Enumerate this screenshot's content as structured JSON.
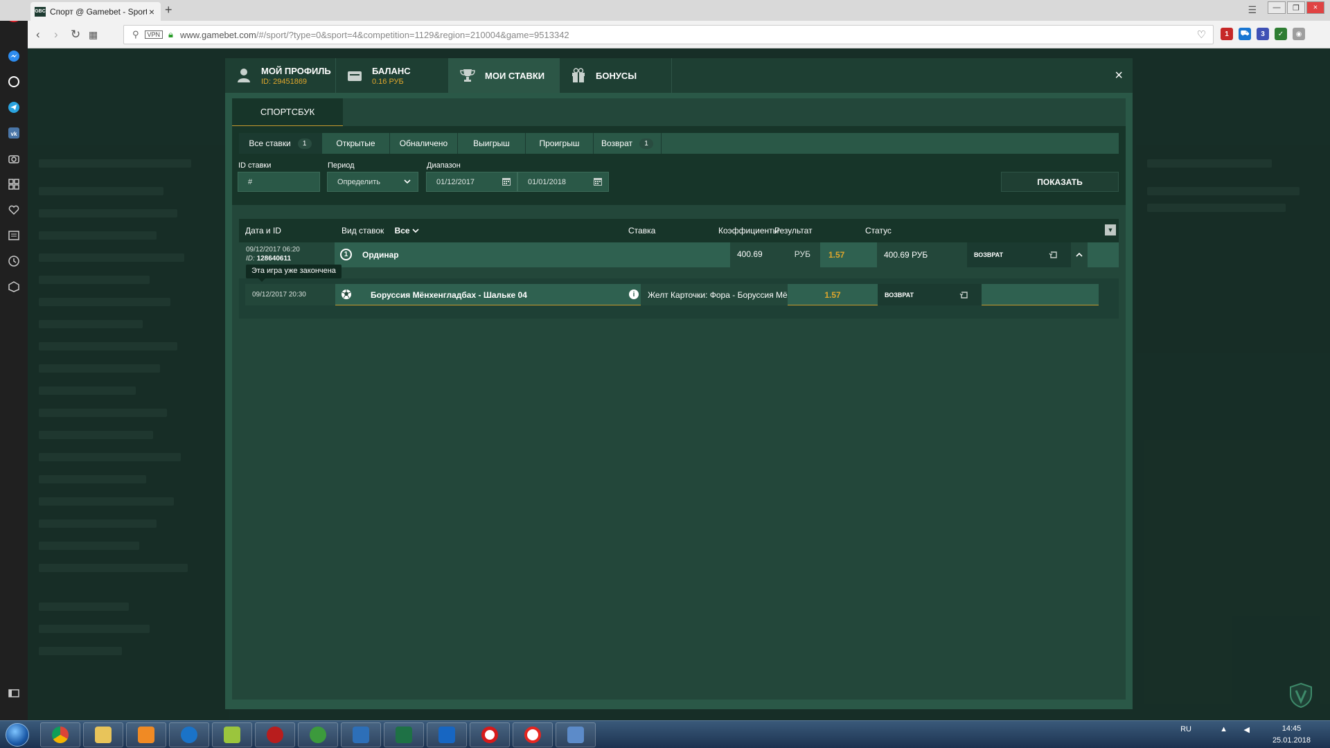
{
  "browser": {
    "tab_title": "Спорт @ Gamebet - Sport",
    "tab_favicon": "GBC",
    "url_domain": "www.gamebet.com",
    "url_path": "/#/sport/?type=0&sport=4&competition=1129&region=210004&game=9513342",
    "vpn_badge": "VPN",
    "ext_badges": [
      "1",
      "3"
    ]
  },
  "modal": {
    "tabs": [
      {
        "label": "МОЙ ПРОФИЛЬ",
        "sub": "ID: 29451869",
        "icon": "user-icon"
      },
      {
        "label": "БАЛАНС",
        "sub": "0.16 РУБ",
        "icon": "wallet-icon"
      },
      {
        "label": "МОИ СТАВКИ",
        "sub": "",
        "icon": "trophy-icon"
      },
      {
        "label": "БОНУСЫ",
        "sub": "",
        "icon": "gift-icon"
      }
    ],
    "active_tab": "МОИ СТАВКИ",
    "close": "×",
    "section_tab": "СПОРТСБУК"
  },
  "filters": {
    "tabs": [
      {
        "label": "Все ставки",
        "count": "1"
      },
      {
        "label": "Открытые",
        "count": ""
      },
      {
        "label": "Обналичено",
        "count": ""
      },
      {
        "label": "Выигрыш",
        "count": ""
      },
      {
        "label": "Проигрыш",
        "count": ""
      },
      {
        "label": "Возврат",
        "count": "1"
      }
    ],
    "bet_id_label": "ID ставки",
    "bet_id_placeholder": "#",
    "period_label": "Период",
    "period_value": "Определить",
    "range_label": "Диапазон",
    "date_from": "01/12/2017",
    "date_to": "01/01/2018",
    "show_button": "ПОКАЗАТЬ"
  },
  "table": {
    "headers": {
      "date_id": "Дата и ID",
      "bet_type": "Вид ставок",
      "bet_type_filter": "Все",
      "stake": "Ставка",
      "odds": "Коэффициенты",
      "result": "Результат",
      "status": "Статус"
    },
    "bet": {
      "datetime": "09/12/2017 06:20",
      "id_prefix": "ID:",
      "id": "128640611",
      "type": "Ординар",
      "stake": "400.69",
      "currency": "РУБ",
      "odds": "1.57",
      "result": "400.69 РУБ",
      "status": "ВОЗВРАТ"
    },
    "tooltip": "Эта игра уже закончена",
    "selection": {
      "datetime": "09/12/2017 20:30",
      "match": "Боруссия Мёнхенгладбах - Шальке 04",
      "market": "Желт Карточки: Фора - Боруссия Мёнхен...",
      "odds": "1.57",
      "status": "ВОЗВРАТ"
    }
  },
  "taskbar": {
    "lang": "RU",
    "time": "14:45",
    "date": "25.01.2018"
  },
  "colors": {
    "accent_gold": "#e0a72c",
    "panel_dark": "#173529",
    "modal_bg": "#2a5847"
  }
}
